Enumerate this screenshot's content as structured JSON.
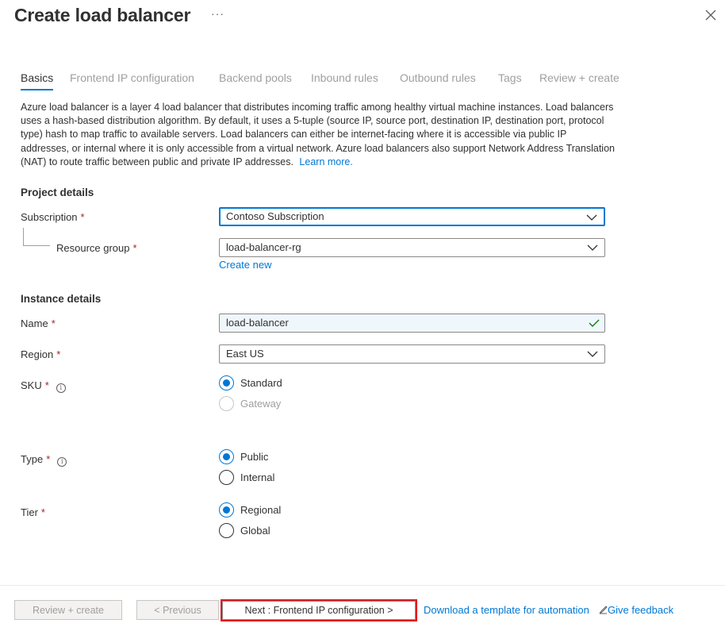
{
  "header": {
    "title": "Create load balancer",
    "more_label": "···"
  },
  "tabs": [
    {
      "label": "Basics"
    },
    {
      "label": "Frontend IP configuration"
    },
    {
      "label": "Backend pools"
    },
    {
      "label": "Inbound rules"
    },
    {
      "label": "Outbound rules"
    },
    {
      "label": "Tags"
    },
    {
      "label": "Review + create"
    }
  ],
  "description": {
    "text": "Azure load balancer is a layer 4 load balancer that distributes incoming traffic among healthy virtual machine instances. Load balancers uses a hash-based distribution algorithm. By default, it uses a 5-tuple (source IP, source port, destination IP, destination port, protocol type) hash to map traffic to available servers. Load balancers can either be internet-facing where it is accessible via public IP addresses, or internal where it is only accessible from a virtual network. Azure load balancers also support Network Address Translation (NAT) to route traffic between public and private IP addresses.",
    "learn_more": "Learn more."
  },
  "project": {
    "heading": "Project details",
    "subscription_label": "Subscription",
    "subscription_value": "Contoso Subscription",
    "resource_group_label": "Resource group",
    "resource_group_value": "load-balancer-rg",
    "create_new": "Create new"
  },
  "instance": {
    "heading": "Instance details",
    "name_label": "Name",
    "name_value": "load-balancer",
    "region_label": "Region",
    "region_value": "East US",
    "sku_label": "SKU",
    "sku_options": [
      "Standard",
      "Gateway"
    ],
    "type_label": "Type",
    "type_options": [
      "Public",
      "Internal"
    ],
    "tier_label": "Tier",
    "tier_options": [
      "Regional",
      "Global"
    ]
  },
  "required_mark": "*",
  "footer": {
    "review_create": "Review + create",
    "previous": "< Previous",
    "next": "Next : Frontend IP configuration >",
    "download_template": "Download a template for automation",
    "give_feedback": "Give feedback"
  },
  "colors": {
    "accent": "#0078d4",
    "required": "#a4262c",
    "highlight_box": "#e0171d",
    "valid_check": "#107c10"
  }
}
